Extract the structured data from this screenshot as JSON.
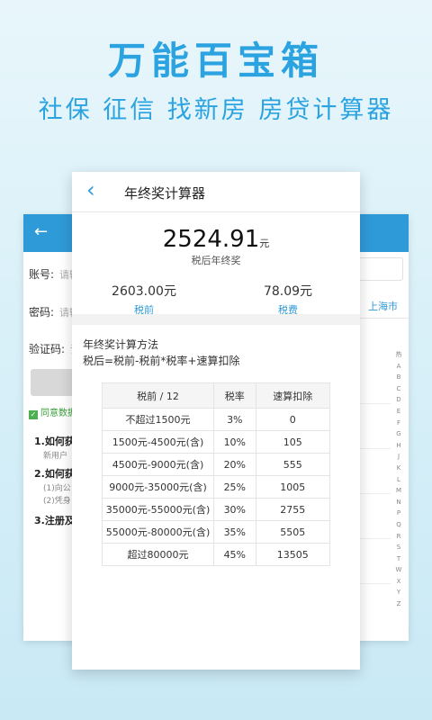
{
  "promo": {
    "headline": "万能百宝箱",
    "subline": "社保 征信 找新房 房贷计算器"
  },
  "left_card": {
    "back_icon": "arrow-left-icon",
    "fields": [
      {
        "label": "账号:",
        "placeholder": "请输"
      },
      {
        "label": "密码:",
        "placeholder": "请输"
      },
      {
        "label": "验证码:",
        "placeholder": "请输"
      }
    ],
    "agree_text": "同意数据",
    "faq": [
      {
        "title": "1.如何获",
        "sub": "新用户"
      },
      {
        "title": "2.如何获",
        "sub": "(1)向公"
      },
      {
        "title": "",
        "sub": "(2)凭身"
      },
      {
        "title": "3.注册及",
        "sub": ""
      }
    ]
  },
  "right_card": {
    "city": "上海市",
    "index_letters": [
      "热",
      "A",
      "B",
      "C",
      "D",
      "E",
      "F",
      "G",
      "H",
      "J",
      "K",
      "L",
      "M",
      "N",
      "P",
      "Q",
      "R",
      "S",
      "T",
      "W",
      "X",
      "Y",
      "Z"
    ]
  },
  "calculator": {
    "back_icon": "chevron-left-icon",
    "title": "年终奖计算器",
    "result_value": "2524.91",
    "result_unit": "元",
    "result_label": "税后年终奖",
    "pre_tax_value": "2603.00元",
    "pre_tax_label": "税前",
    "tax_value": "78.09元",
    "tax_label": "税费",
    "method_title": "年终奖计算方法",
    "method_formula": "税后=税前-税前*税率+速算扣除",
    "table": {
      "headers": [
        "税前 / 12",
        "税率",
        "速算扣除"
      ],
      "rows": [
        [
          "不超过1500元",
          "3%",
          "0"
        ],
        [
          "1500元-4500元(含)",
          "10%",
          "105"
        ],
        [
          "4500元-9000元(含)",
          "20%",
          "555"
        ],
        [
          "9000元-35000元(含)",
          "25%",
          "1005"
        ],
        [
          "35000元-55000元(含)",
          "30%",
          "2755"
        ],
        [
          "55000元-80000元(含)",
          "35%",
          "5505"
        ],
        [
          "超过80000元",
          "45%",
          "13505"
        ]
      ]
    }
  },
  "colors": {
    "accent": "#2aa3e0",
    "bar": "#2f9ad8"
  }
}
